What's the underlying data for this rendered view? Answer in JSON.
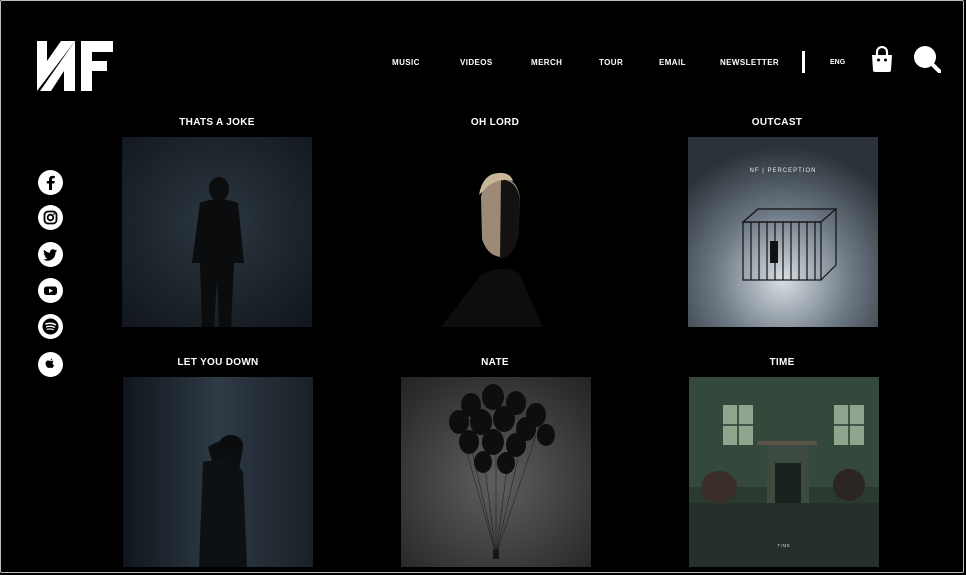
{
  "header": {
    "logo_alt": "NF",
    "nav": [
      "MUSIC",
      "VIDEOS",
      "MERCH",
      "TOUR",
      "EMAIL",
      "NEWSLETTER"
    ],
    "language": "ENG",
    "icons": [
      "shopping-bag-icon",
      "search-icon"
    ]
  },
  "social": [
    "facebook-icon",
    "instagram-icon",
    "twitter-icon",
    "youtube-icon",
    "spotify-icon",
    "apple-icon"
  ],
  "tiles": [
    {
      "title": "THATS A JOKE"
    },
    {
      "title": "OH LORD"
    },
    {
      "title": "OUTCAST",
      "cover_text": "NF | PERCEPTION"
    },
    {
      "title": "LET YOU DOWN"
    },
    {
      "title": "NATE"
    },
    {
      "title": "TIME",
      "cover_text": "TIME"
    }
  ],
  "colors": {
    "background": "#000000",
    "text": "#ffffff",
    "frame": "#bdbdbd"
  }
}
